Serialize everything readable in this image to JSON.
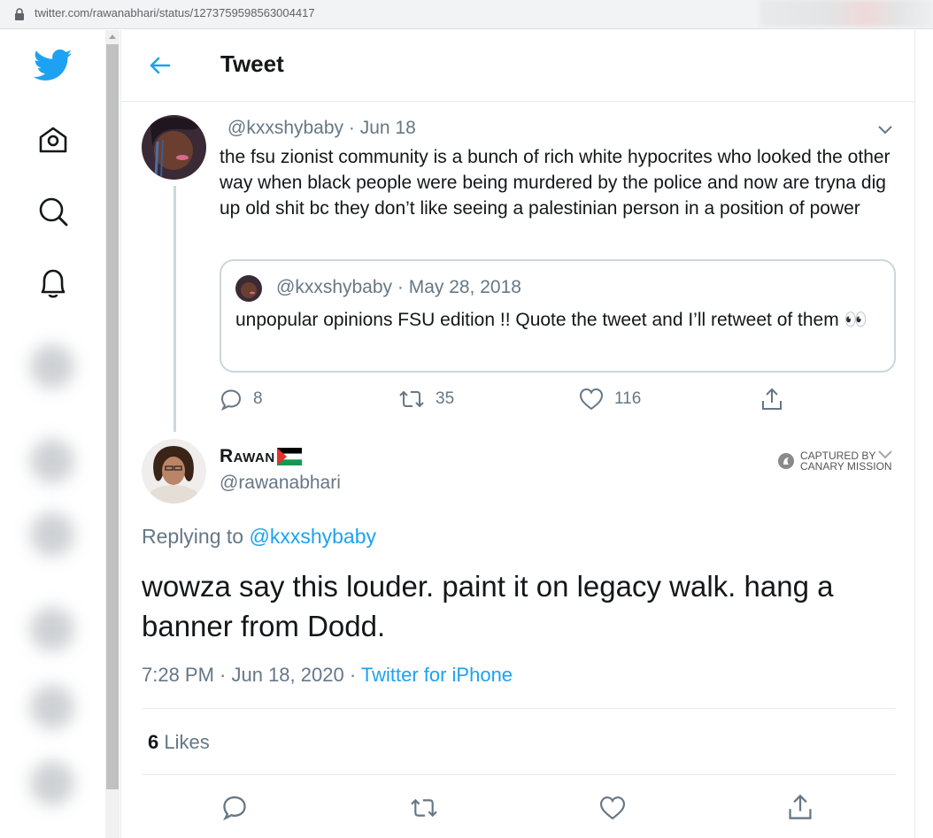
{
  "browser": {
    "url": "twitter.com/rawanabhari/status/1273759598563004417"
  },
  "header": {
    "title": "Tweet"
  },
  "parent_tweet": {
    "handle": "@kxxshybaby",
    "date": "Jun 18",
    "handle_line": "@kxxshybaby · Jun 18",
    "text": "the fsu zionist community is a bunch of rich white hypocrites who looked the other way when black people were being murdered by the police and now are tryna dig up old shit bc they don’t like seeing a palestinian person in a position of power",
    "quoted": {
      "handle_line": "@kxxshybaby · May 28, 2018",
      "text": "unpopular opinions FSU edition !! Quote the tweet and I’ll retweet of them 👀"
    },
    "replies": "8",
    "retweets": "35",
    "likes": "116"
  },
  "focus_tweet": {
    "display_name": "Rawan",
    "handle": "@rawanabhari",
    "watermark_line1": "CAPTURED BY",
    "watermark_line2": "CANARY MISSION",
    "replying_prefix": "Replying to ",
    "replying_to": "@kxxshybaby",
    "text": "wowza say this louder. paint it on legacy walk. hang a banner from Dodd.",
    "timestamp": "7:28 PM · Jun 18, 2020 · ",
    "source": "Twitter for iPhone",
    "likes_count": "6",
    "likes_label": " Likes"
  },
  "colors": {
    "twitter_blue": "#1da1f2",
    "secondary_text": "#657786",
    "border": "#e6ecf0"
  }
}
